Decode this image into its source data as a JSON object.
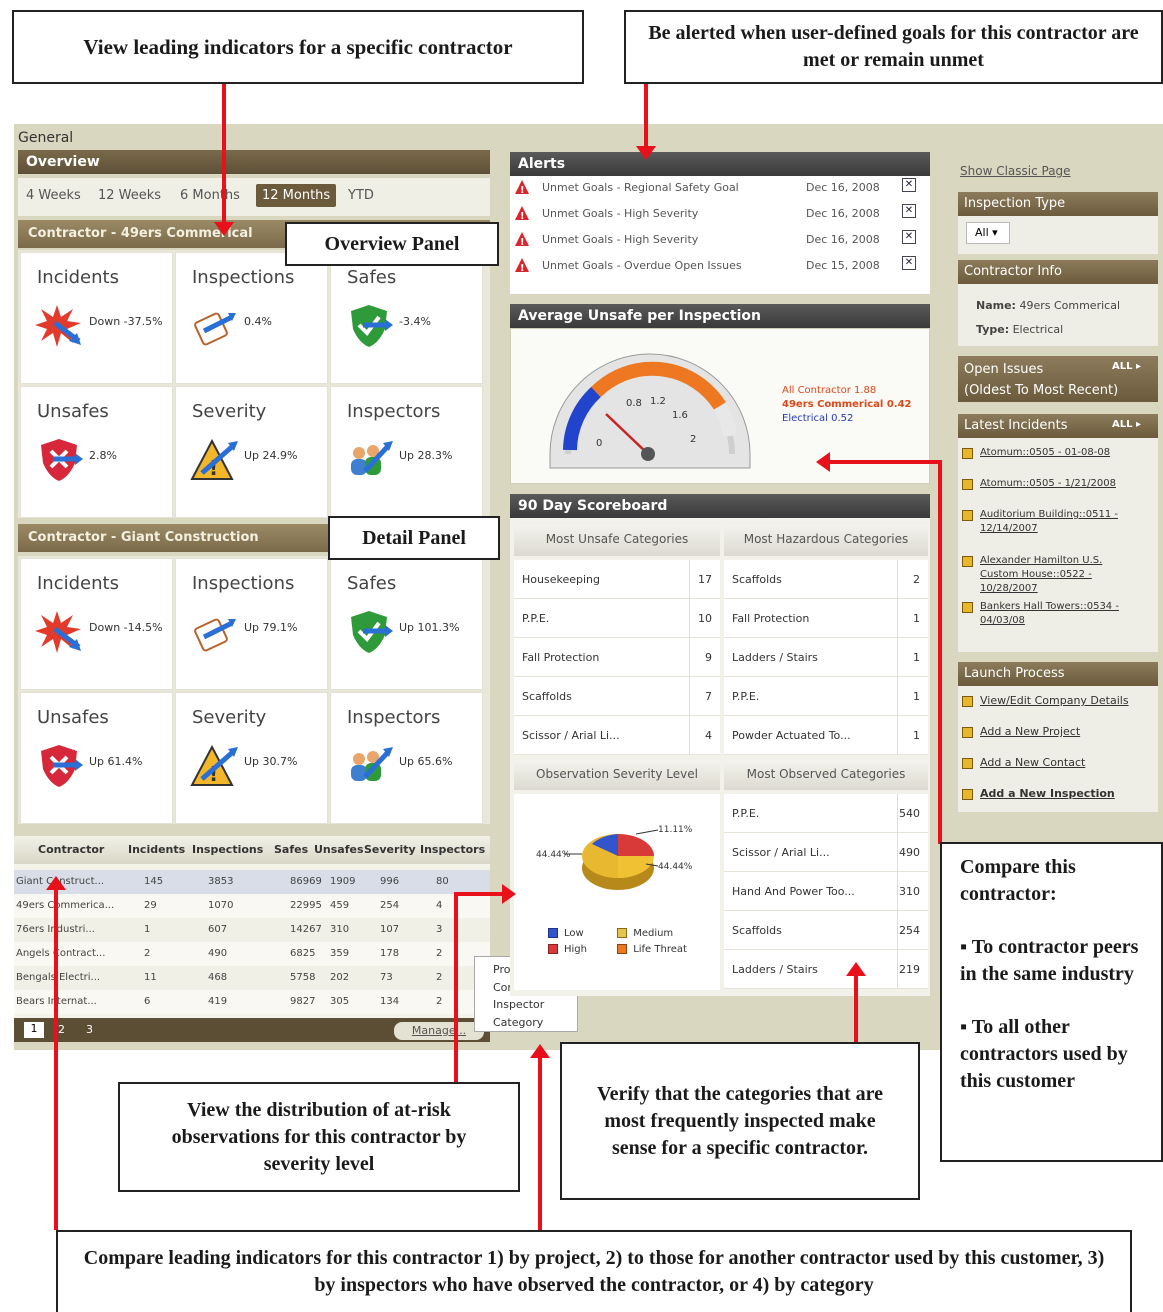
{
  "callouts": {
    "top_left": "View leading indicators for a specific contractor",
    "top_right": "Be alerted when user-defined goals for this contractor are met or remain unmet",
    "overview_panel": "Overview Panel",
    "detail_panel": "Detail Panel",
    "distribution": "View the distribution of at-risk observations for this contractor by severity level",
    "verify": "Verify that the categories that are most frequently inspected make sense for a specific contractor.",
    "compare_title": "Compare this contractor:",
    "compare_b1": "▪ To contractor peers in the same industry",
    "compare_b2": "▪ To all other contractors used by this customer",
    "bottom": "Compare leading indicators for this contractor 1) by project, 2) to those for another contractor used by this customer, 3) by inspectors who have observed the contractor, or 4) by category"
  },
  "app": {
    "general_label": "General",
    "overview_title": "Overview",
    "tabs": [
      "4 Weeks",
      "12 Weeks",
      "6 Months",
      "12 Months",
      "YTD"
    ],
    "active_tab": "12 Months",
    "contractor1": {
      "title": "Contractor - 49ers Commerical",
      "cells": [
        {
          "label": "Incidents",
          "value": "Down -37.5%",
          "icon": "burst-icon"
        },
        {
          "label": "Inspections",
          "value": "0.4%",
          "icon": "clipboard-icon"
        },
        {
          "label": "Safes",
          "value": "-3.4%",
          "icon": "shield-check-icon"
        },
        {
          "label": "Unsafes",
          "value": "2.8%",
          "icon": "shield-x-icon"
        },
        {
          "label": "Severity",
          "value": "Up 24.9%",
          "icon": "warning-icon"
        },
        {
          "label": "Inspectors",
          "value": "Up 28.3%",
          "icon": "people-icon"
        }
      ]
    },
    "contractor2": {
      "title": "Contractor - Giant Construction",
      "cells": [
        {
          "label": "Incidents",
          "value": "Down -14.5%",
          "icon": "burst-icon"
        },
        {
          "label": "Inspections",
          "value": "Up 79.1%",
          "icon": "clipboard-icon"
        },
        {
          "label": "Safes",
          "value": "Up 101.3%",
          "icon": "shield-check-icon"
        },
        {
          "label": "Unsafes",
          "value": "Up 61.4%",
          "icon": "shield-x-icon"
        },
        {
          "label": "Severity",
          "value": "Up 30.7%",
          "icon": "warning-icon"
        },
        {
          "label": "Inspectors",
          "value": "Up 65.6%",
          "icon": "people-icon"
        }
      ]
    },
    "table": {
      "headers": [
        "Contractor",
        "Incidents",
        "Inspections",
        "Safes",
        "Unsafes",
        "Severity",
        "Inspectors"
      ],
      "rows": [
        [
          "Giant Construct...",
          "145",
          "3853",
          "86969",
          "1909",
          "996",
          "80"
        ],
        [
          "49ers Commerica...",
          "29",
          "1070",
          "22995",
          "459",
          "254",
          "4"
        ],
        [
          "76ers Industri...",
          "1",
          "607",
          "14267",
          "310",
          "107",
          "3"
        ],
        [
          "Angels Contract...",
          "2",
          "490",
          "6825",
          "359",
          "178",
          "2"
        ],
        [
          "Bengals Electri...",
          "11",
          "468",
          "5758",
          "202",
          "73",
          "2"
        ],
        [
          "Bears Internat...",
          "6",
          "419",
          "9827",
          "305",
          "134",
          "2"
        ]
      ],
      "pages": [
        "1",
        "2",
        "3"
      ],
      "manage_label": "Manage..."
    },
    "context_menu": [
      "Project",
      "Contractor",
      "Inspector",
      "Category"
    ],
    "alerts": {
      "title": "Alerts",
      "rows": [
        {
          "text": "Unmet Goals - Regional Safety Goal",
          "date": "Dec 16, 2008"
        },
        {
          "text": "Unmet Goals - High Severity",
          "date": "Dec 16, 2008"
        },
        {
          "text": "Unmet Goals - High Severity",
          "date": "Dec 16, 2008"
        },
        {
          "text": "Unmet Goals - Overdue Open Issues",
          "date": "Dec 15, 2008"
        }
      ]
    },
    "gauge": {
      "title": "Average Unsafe per Inspection",
      "legend": [
        {
          "text": "All Contractor 1.88",
          "color": "#d94a1a"
        },
        {
          "text": "49ers Commerical 0.42",
          "color": "#d94a1a"
        },
        {
          "text": "Electrical 0.52",
          "color": "#2a3ab0"
        }
      ],
      "ticks": [
        "0",
        "0.8",
        "1.2",
        "1.6",
        "2"
      ],
      "needle_value": 0.42
    },
    "scoreboard": {
      "title": "90 Day Scoreboard",
      "unsafe_header": "Most Unsafe Categories",
      "hazard_header": "Most Hazardous Categories",
      "unsafe": [
        [
          "Housekeeping",
          "17"
        ],
        [
          "P.P.E.",
          "10"
        ],
        [
          "Fall Protection",
          "9"
        ],
        [
          "Scaffolds",
          "7"
        ],
        [
          "Scissor / Arial Li...",
          "4"
        ]
      ],
      "hazard": [
        [
          "Scaffolds",
          "2"
        ],
        [
          "Fall Protection",
          "1"
        ],
        [
          "Ladders / Stairs",
          "1"
        ],
        [
          "P.P.E.",
          "1"
        ],
        [
          "Powder Actuated To...",
          "1"
        ]
      ],
      "severity_header": "Observation Severity Level",
      "observed_header": "Most Observed Categories",
      "observed": [
        [
          "P.P.E.",
          "540"
        ],
        [
          "Scissor / Arial Li...",
          "490"
        ],
        [
          "Hand And Power Too...",
          "310"
        ],
        [
          "Scaffolds",
          "254"
        ],
        [
          "Ladders / Stairs",
          "219"
        ]
      ],
      "pie_labels": [
        "11.11%",
        "44.44%",
        "44.44%"
      ],
      "pie_legend": [
        "Low",
        "Medium",
        "High",
        "Life Threat"
      ]
    },
    "right": {
      "classic": "Show Classic Page",
      "inspection_type": "Inspection Type",
      "all_select": "All",
      "contractor_info": "Contractor Info",
      "name_label": "Name:",
      "name_value": "49ers Commerical",
      "type_label": "Type:",
      "type_value": "Electrical",
      "open_issues": "Open Issues",
      "open_issues_sub": "(Oldest To Most Recent)",
      "all_btn": "ALL",
      "latest_incidents": "Latest Incidents",
      "incidents": [
        "Atomum::0505 - 01-08-08",
        "Atomum::0505 - 1/21/2008",
        "Auditorium Building::0511 - 12/14/2007",
        "Alexander Hamilton U.S. Custom House::0522 - 10/28/2007",
        "Bankers Hall Towers::0534 - 04/03/08"
      ],
      "launch": "Launch Process",
      "launch_items": [
        "View/Edit Company Details",
        "Add a New Project",
        "Add a New Contact",
        "Add a New Inspection"
      ]
    }
  }
}
